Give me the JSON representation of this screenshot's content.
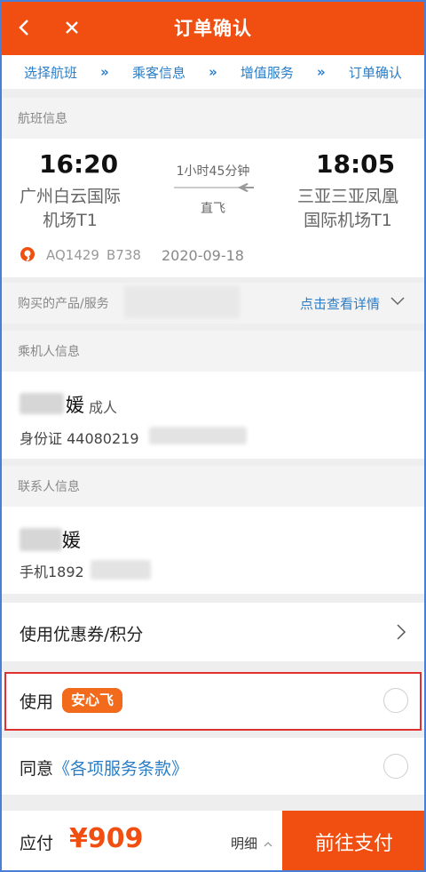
{
  "header": {
    "title": "订单确认"
  },
  "steps": [
    "选择航班",
    "乘客信息",
    "增值服务",
    "订单确认"
  ],
  "step_separator": "»",
  "flight_section": {
    "heading": "航班信息"
  },
  "flight": {
    "dep_time": "16:20",
    "dep_airport_line1": "广州白云国际",
    "dep_airport_line2": "机场T1",
    "duration": "1小时45分钟",
    "type": "直飞",
    "arr_time": "18:05",
    "arr_airport_line1": "三亚三亚凤凰",
    "arr_airport_line2": "国际机场T1",
    "flight_no": "AQ1429",
    "aircraft": "B738",
    "date": "2020-09-18"
  },
  "product": {
    "label": "购买的产品/服务",
    "link": "点击查看详情"
  },
  "passenger_section": {
    "heading": "乘机人信息"
  },
  "passenger": {
    "name": "媛",
    "type": "成人",
    "id_line": "身份证 44080219"
  },
  "contact_section": {
    "heading": "联系人信息"
  },
  "contact": {
    "name": "媛",
    "phone": "手机1892"
  },
  "coupon": {
    "label": "使用优惠券/积分"
  },
  "anxin": {
    "prefix": "使用",
    "badge": "安心飞"
  },
  "agree": {
    "prefix": "同意",
    "terms": "《各项服务条款》"
  },
  "bottom": {
    "pay_label": "应付",
    "price": "¥909",
    "detail": "明细",
    "pay_button": "前往支付"
  },
  "colors": {
    "brand": "#f04f11",
    "link": "#2a7ec8",
    "highlight": "#e03030"
  }
}
